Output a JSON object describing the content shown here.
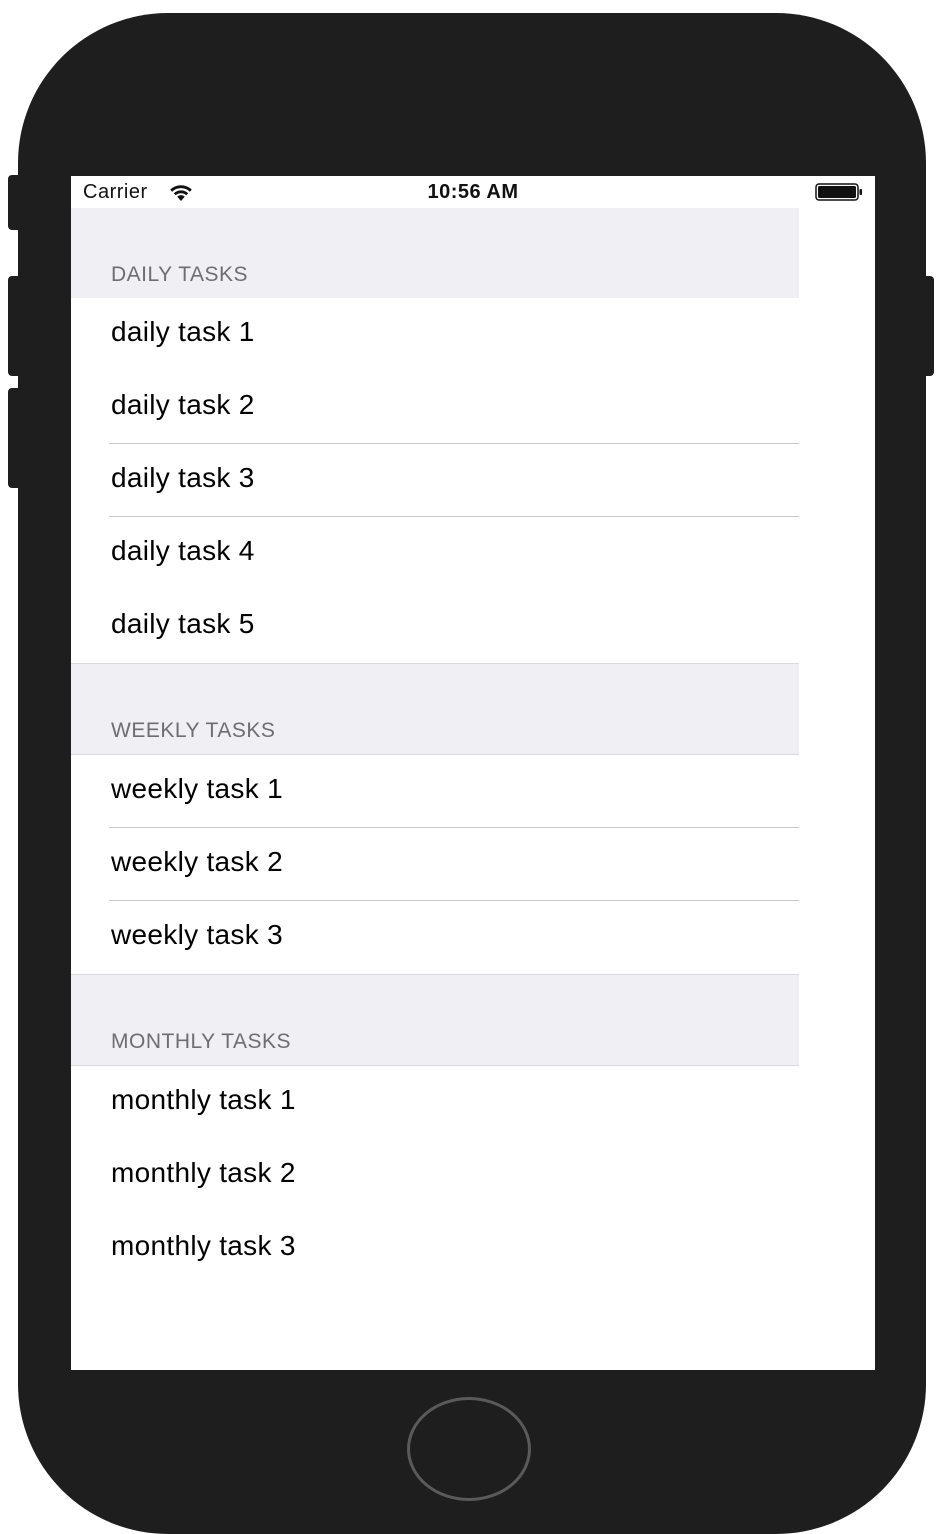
{
  "status_bar": {
    "carrier": "Carrier",
    "time": "10:56 AM",
    "wifi_icon": "wifi-icon",
    "battery_icon": "battery-full-icon"
  },
  "sections": [
    {
      "title": "DAILY TASKS",
      "rows": [
        "daily task 1",
        "daily task 2",
        "daily task 3",
        "daily task 4",
        "daily task 5"
      ]
    },
    {
      "title": "WEEKLY TASKS",
      "rows": [
        "weekly task 1",
        "weekly task 2",
        "weekly task 3"
      ]
    },
    {
      "title": "MONTHLY TASKS",
      "rows": [
        "monthly task 1",
        "monthly task 2",
        "monthly task 3"
      ]
    }
  ],
  "colors": {
    "device_body": "#1e1e1e",
    "section_header_bg": "#efeff4",
    "section_header_text": "#6d6d72",
    "separator": "#c8c7cc"
  }
}
